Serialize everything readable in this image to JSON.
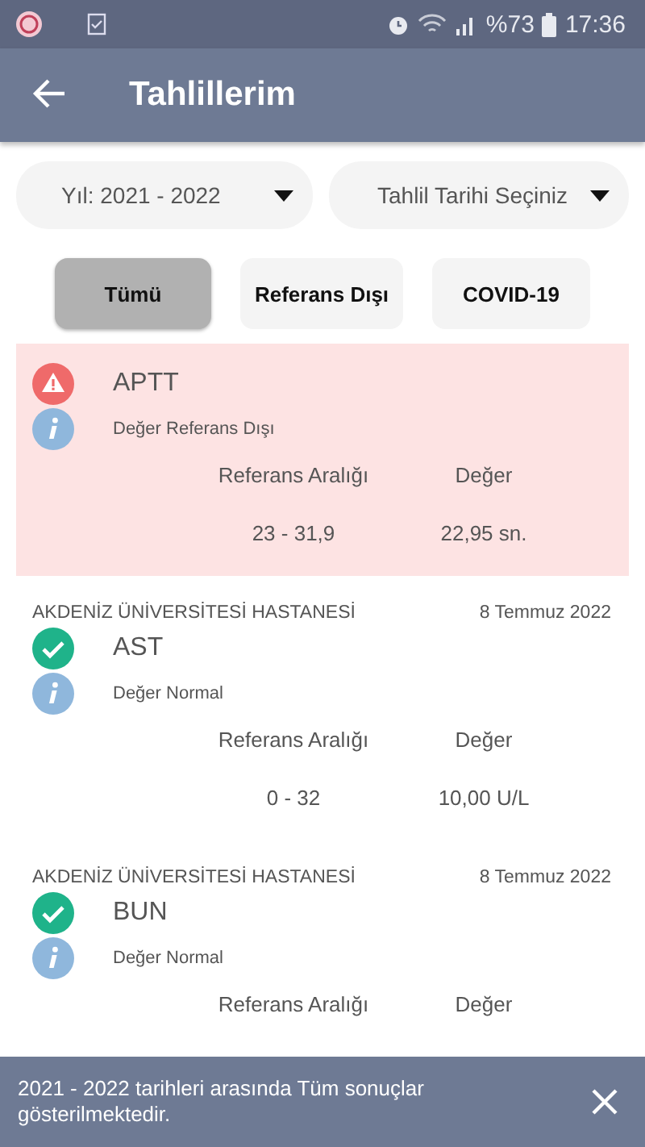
{
  "status_bar": {
    "battery": "%73",
    "time": "17:36"
  },
  "app_bar": {
    "title": "Tahlillerim"
  },
  "dropdowns": [
    {
      "value": "Yıl: 2021 - 2022"
    },
    {
      "value": "Tahlil Tarihi Seçiniz"
    }
  ],
  "filters": [
    {
      "label": "Tümü",
      "selected": true
    },
    {
      "label": "Referans Dışı",
      "selected": false
    },
    {
      "label": "COVID-19",
      "selected": false
    }
  ],
  "results": [
    {
      "kind": "abnormal",
      "name": "APTT",
      "note": "Değer Referans Dışı",
      "range_label": "Referans Aralığı",
      "value_label": "Değer",
      "range": "23 - 31,9",
      "value": "22,95 sn."
    },
    {
      "kind": "normal",
      "hospital": "AKDENİZ ÜNİVERSİTESİ HASTANESİ",
      "date": "8 Temmuz 2022",
      "name": "AST",
      "note": "Değer Normal",
      "range_label": "Referans Aralığı",
      "value_label": "Değer",
      "range": "0 - 32",
      "value": "10,00 U/L"
    },
    {
      "kind": "normal",
      "hospital": "AKDENİZ ÜNİVERSİTESİ HASTANESİ",
      "date": "8 Temmuz 2022",
      "name": "BUN",
      "note": "Değer Normal",
      "range_label": "Referans Aralığı",
      "value_label": "Değer"
    }
  ],
  "snackbar": {
    "message": "2021 - 2022 tarihleri arasında Tüm sonuçlar gösterilmektedir."
  }
}
